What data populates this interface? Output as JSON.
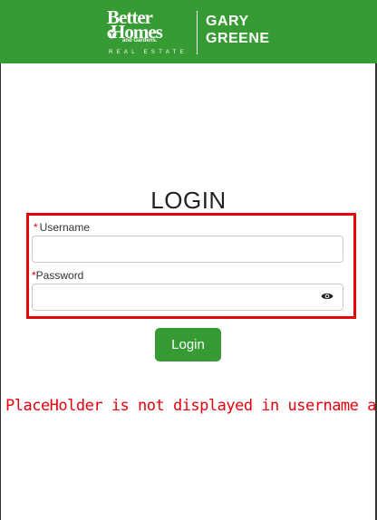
{
  "header": {
    "brand_line1": "Better",
    "brand_line2": "Homes",
    "brand_sub": "and Gardens.",
    "brand_tag": "REAL ESTATE",
    "brand_right_line1": "GARY",
    "brand_right_line2": "GREENE",
    "color": "#369b32"
  },
  "form": {
    "title": "LOGIN",
    "required_marker": "*",
    "username_label": "Username",
    "username_value": "",
    "password_label": "Password",
    "password_value": "",
    "show_password_icon": "eye-icon",
    "login_label": "Login"
  },
  "annotation": {
    "text": "PlaceHolder is not displayed in username and pss",
    "color": "#e8000b"
  }
}
